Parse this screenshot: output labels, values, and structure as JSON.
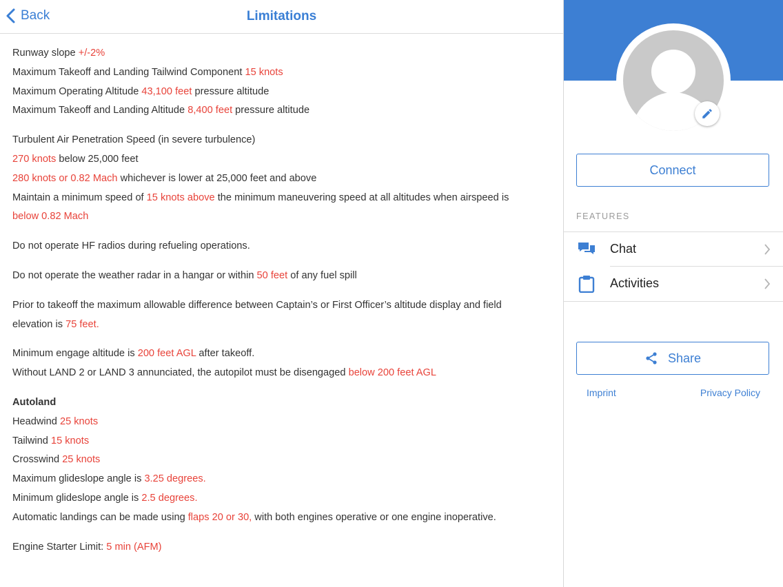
{
  "nav": {
    "back_label": "Back",
    "title": "Limitations"
  },
  "limits": {
    "l1": {
      "t1": "Runway slope ",
      "h1": "+/-2%"
    },
    "l2": {
      "t1": "Maximum Takeoff and Landing Tailwind Component ",
      "h1": "15 knots"
    },
    "l3": {
      "t1": "Maximum Operating Altitude ",
      "h1": "43,100 feet",
      "t2": " pressure altitude"
    },
    "l4": {
      "t1": "Maximum Takeoff and Landing Altitude ",
      "h1": "8,400 feet",
      "t2": " pressure altitude"
    },
    "l5": {
      "t1": "Turbulent Air Penetration Speed (in severe turbulence)"
    },
    "l6": {
      "h1": "270 knots",
      "t1": " below 25,000 feet"
    },
    "l7": {
      "h1": "280 knots or 0.82 Mach",
      "t1": " whichever is lower at 25,000 feet and above"
    },
    "l8": {
      "t1": "Maintain a minimum speed of ",
      "h1": "15 knots above",
      "t2": " the minimum maneuvering speed at all altitudes when airspeed is"
    },
    "l9": {
      "h1": "below 0.82 Mach"
    },
    "l10": {
      "t1": "Do not operate HF radios during refueling operations."
    },
    "l11": {
      "t1": "Do not operate the weather radar in a hangar or within ",
      "h1": "50 feet",
      "t2": " of any fuel spill"
    },
    "l12": {
      "t1": "Prior to takeoff the maximum allowable difference between Captain’s or First Officer’s altitude display and field"
    },
    "l13": {
      "t1": "elevation is ",
      "h1": "75 feet."
    },
    "l14": {
      "t1": "Minimum engage altitude is ",
      "h1": "200 feet AGL",
      "t2": " after takeoff."
    },
    "l15": {
      "t1": "Without LAND 2 or LAND 3 annunciated, the autopilot must be disengaged ",
      "h1": "below 200 feet AGL"
    },
    "autoland_heading": "Autoland",
    "l16": {
      "t1": "Headwind ",
      "h1": "25 knots"
    },
    "l17": {
      "t1": "Tailwind ",
      "h1": "15 knots"
    },
    "l18": {
      "t1": "Crosswind ",
      "h1": "25 knots"
    },
    "l19": {
      "t1": "Maximum glideslope angle is ",
      "h1": "3.25 degrees."
    },
    "l20": {
      "t1": "Minimum glideslope angle is ",
      "h1": "2.5 degrees."
    },
    "l21": {
      "t1": "Automatic landings can be made using ",
      "h1": "flaps 20 or 30,",
      "t2": " with both engines operative or one engine inoperative."
    },
    "l22": {
      "t1": "Engine Starter Limit: ",
      "h1": "5 min (AFM)"
    }
  },
  "sidebar": {
    "connect_label": "Connect",
    "features_label": "FEATURES",
    "items": [
      {
        "label": "Chat",
        "icon": "chat-icon"
      },
      {
        "label": "Activities",
        "icon": "clipboard-icon"
      }
    ],
    "share_label": "Share",
    "imprint_label": "Imprint",
    "privacy_label": "Privacy Policy"
  },
  "colors": {
    "accent": "#3d7fd3",
    "highlight": "#e8433a",
    "text": "#333333"
  }
}
